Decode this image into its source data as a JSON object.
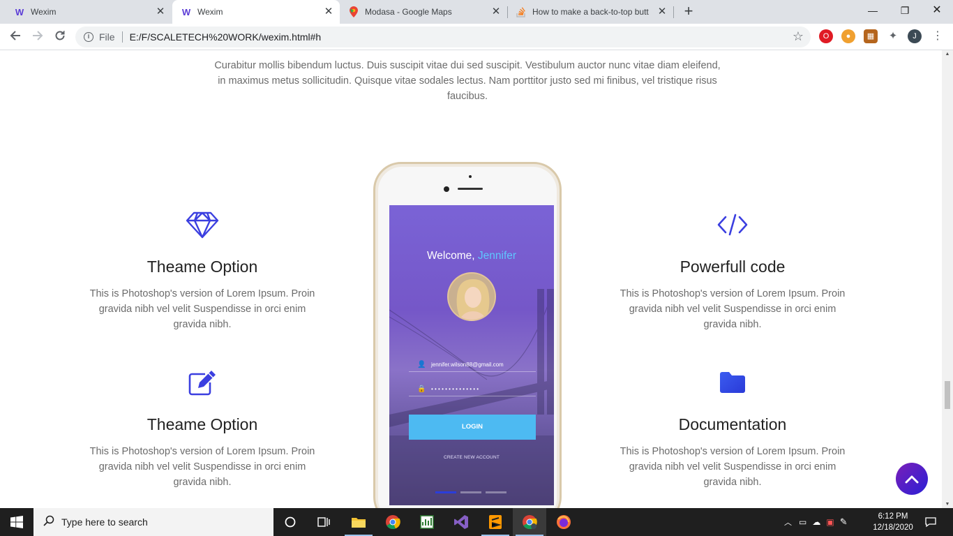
{
  "browser": {
    "tabs": [
      {
        "title": "Wexim",
        "favicon": "W"
      },
      {
        "title": "Wexim",
        "favicon": "W"
      },
      {
        "title": "Modasa - Google Maps",
        "favicon": "maps-pin"
      },
      {
        "title": "How to make a back-to-top butt",
        "favicon": "stackoverflow"
      }
    ],
    "new_tab_label": "+",
    "url_scheme": "File",
    "url": "E:/F/SCALETECH%20WORK/wexim.html#h",
    "profile_initial": "J"
  },
  "page": {
    "intro_text": "Curabitur mollis bibendum luctus. Duis suscipit vitae dui sed suscipit. Vestibulum auctor nunc vitae diam eleifend, in maximus metus sollicitudin. Quisque vitae sodales lectus. Nam porttitor justo sed mi finibus, vel tristique risus faucibus.",
    "features": [
      {
        "icon": "diamond-icon",
        "title": "Theame Option",
        "text": "This is Photoshop's version of Lorem Ipsum. Proin gravida nibh vel velit Suspendisse in orci enim gravida nibh."
      },
      {
        "icon": "code-icon",
        "title": "Powerfull code",
        "text": "This is Photoshop's version of Lorem Ipsum. Proin gravida nibh vel velit Suspendisse in orci enim gravida nibh."
      },
      {
        "icon": "edit-icon",
        "title": "Theame Option",
        "text": "This is Photoshop's version of Lorem Ipsum. Proin gravida nibh vel velit Suspendisse in orci enim gravida nibh."
      },
      {
        "icon": "folder-icon",
        "title": "Documentation",
        "text": "This is Photoshop's version of Lorem Ipsum. Proin gravida nibh vel velit Suspendisse in orci enim gravida nibh."
      }
    ],
    "phone": {
      "welcome": "Welcome,",
      "user_name": "Jennifer",
      "email": "jennifer.wilson88@gmail.com",
      "password_mask": "• • • • • • • • • • • • • •",
      "login_label": "LOGIN",
      "create_account_label": "CREATE NEW ACCOUNT"
    },
    "accent_color": "#3b3fe0"
  },
  "taskbar": {
    "search_placeholder": "Type here to search",
    "time": "6:12 PM",
    "date": "12/18/2020"
  }
}
